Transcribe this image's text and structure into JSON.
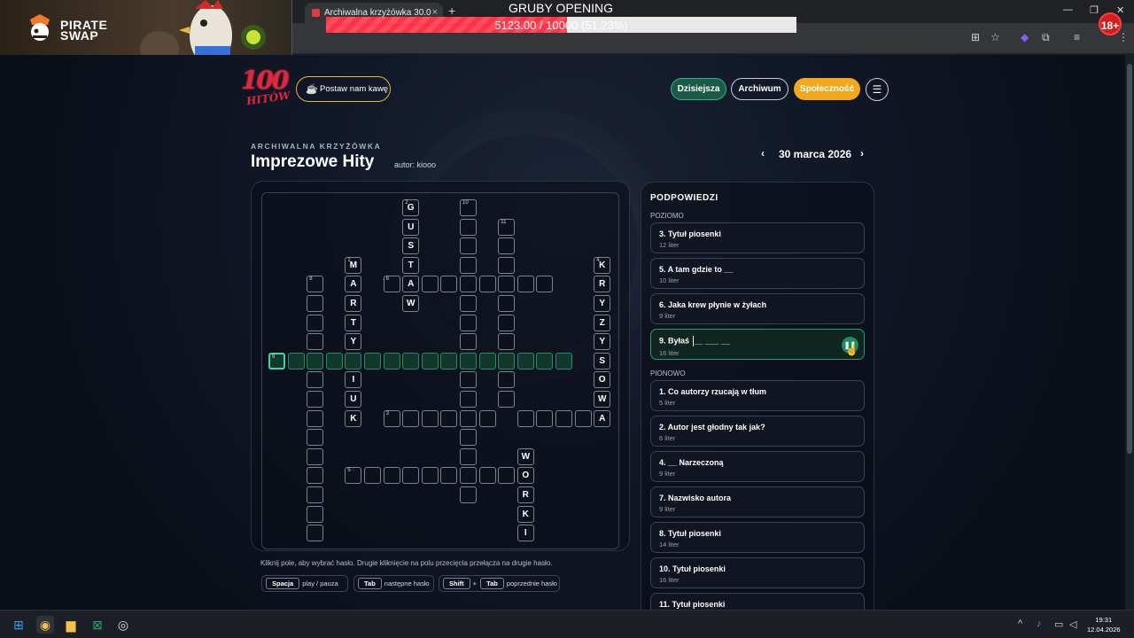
{
  "browser": {
    "tab_title": "Archiwalna krzyżówka 30.0",
    "tab_close": "×",
    "new_tab": "+",
    "nav_back": "‹",
    "min": "—",
    "max": "❐",
    "close": "✕",
    "toolbar_icons": [
      "translate-icon",
      "star-icon",
      "extension-icon",
      "puzzle-icon",
      "media-icon",
      "profile-icon",
      "kebab-icon"
    ]
  },
  "stream": {
    "brand_line1": "PIRATE",
    "brand_line2": "SWAP",
    "goal_title": "GRUBY OPENING",
    "goal_text": "5123.00 / 10000 (51.23%)",
    "goal_fraction": 0.5123,
    "badge": "18+",
    "colors": {
      "bar_fill": "#ff3347",
      "bar_bg": "#e8e8e8"
    }
  },
  "header": {
    "logo_num": "100",
    "logo_text": "HITÓW",
    "coffee_label": "Postaw nam kawę",
    "nav": {
      "today": "Dzisiejsza",
      "archive": "Archiwum",
      "community": "Społeczność"
    },
    "menu_icon": "☰"
  },
  "puzzle": {
    "archive_label": "ARCHIWALNA KRZYŻÓWKA",
    "title": "Imprezowe Hity",
    "author": "autor: kiooo",
    "date": "30 marca 2026",
    "prev": "‹",
    "next": "›"
  },
  "grid_letters": {
    "g": "G",
    "u": "U",
    "s": "S",
    "t": "T",
    "a": "A",
    "w": "W",
    "m": "M",
    "a2": "A",
    "r": "R",
    "t2": "T",
    "y": "Y",
    "i": "I",
    "u2": "U",
    "k": "K",
    "k1": "K",
    "r1": "R",
    "y1": "Y",
    "z1": "Z",
    "y2": "Y",
    "s1": "S",
    "o1": "O",
    "w1": "W",
    "a3": "A",
    "w2": "W",
    "o2": "O",
    "r2": "R",
    "k2": "K",
    "i2": "I"
  },
  "grid_numbers": {
    "n2": "2",
    "n10": "10",
    "n11": "11",
    "n1": "1",
    "n4": "4",
    "n8": "8",
    "n6": "6",
    "n9": "9",
    "n3": "3",
    "n5": "5"
  },
  "instructions": {
    "text": "Kliknij pole, aby wybrać hasło. Drugie kliknięcie na polu przecięcia przełącza na drugie hasło.",
    "k1": "Spacja",
    "k1_desc": "play / pauza",
    "k2": "Tab",
    "k2_desc": "następne hasło",
    "k3a": "Shift",
    "plus": "+",
    "k3b": "Tab",
    "k3_desc": "poprzednie hasło"
  },
  "hints": {
    "title": "PODPOWIEDZI",
    "across_label": "POZIOMO",
    "down_label": "PIONOWO",
    "across": [
      {
        "label": "3. Tytuł piosenki",
        "len": "12 liter"
      },
      {
        "label": "5. A tam gdzie to __",
        "len": "10 liter"
      },
      {
        "label": "6. Jaka krew płynie w żyłach",
        "len": "9 liter"
      },
      {
        "label": "9. Byłaś",
        "label_rest": "__ ___ __",
        "len": "16 liter",
        "play": "❚❚"
      }
    ],
    "down": [
      {
        "label": "1. Co autorzy rzucają w tłum",
        "len": "5 liter"
      },
      {
        "label": "2. Autor jest głodny tak jak?",
        "len": "6 liter"
      },
      {
        "label": "4. __ Narzeczoną",
        "len": "9 liter"
      },
      {
        "label": "7. Nazwisko autora",
        "len": "9 liter"
      },
      {
        "label": "8. Tytuł piosenki",
        "len": "14 liter"
      },
      {
        "label": "10. Tytuł piosenki",
        "len": "16 liter"
      },
      {
        "label": "11. Tytuł piosenki",
        "len": ""
      }
    ]
  },
  "taskbar": {
    "time": "19:31",
    "date": "12.04.2026"
  }
}
